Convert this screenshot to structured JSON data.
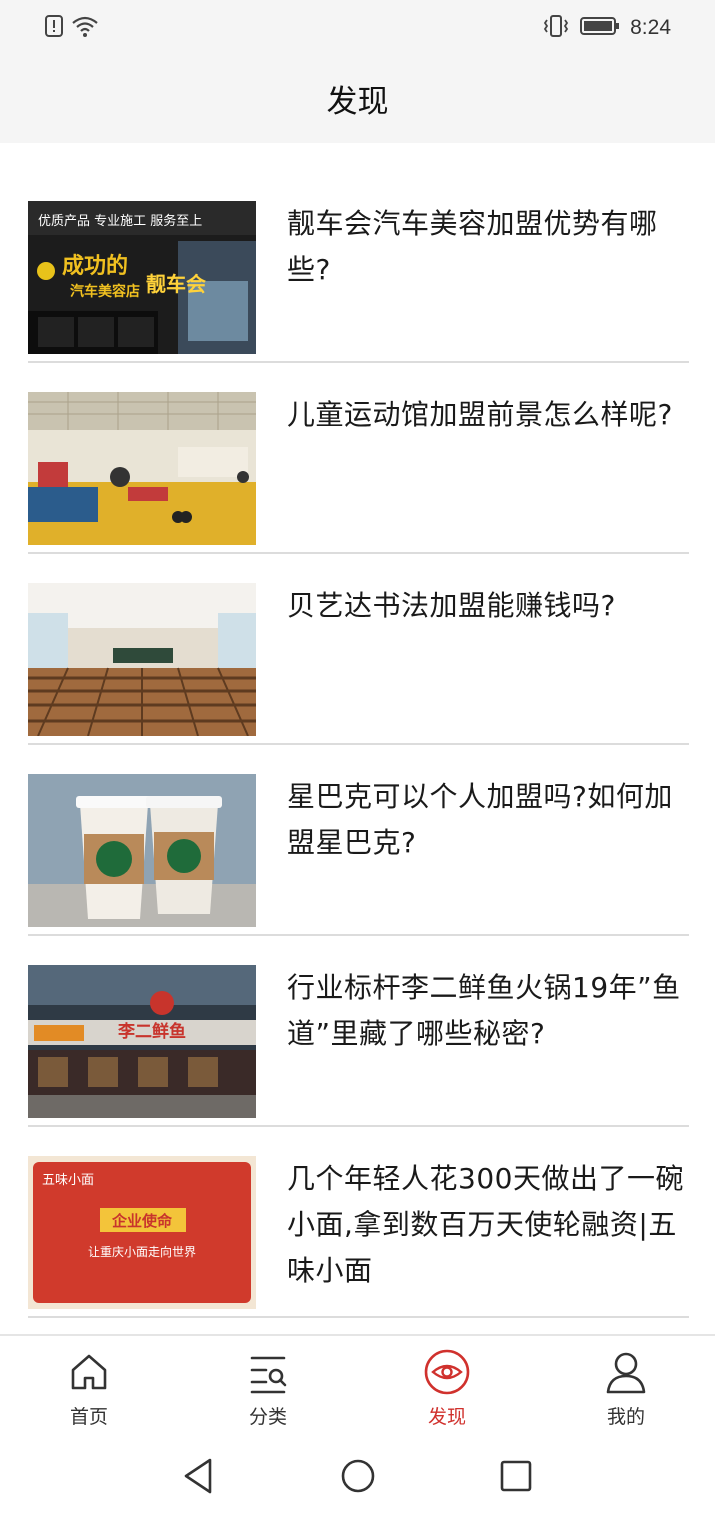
{
  "status_bar": {
    "time": "8:24",
    "icons": [
      "alert-icon",
      "wifi-icon",
      "vibrate-icon",
      "battery-icon"
    ]
  },
  "header": {
    "title": "发现"
  },
  "articles": [
    {
      "title": "靓车会汽车美容加盟优势有哪些?",
      "thumb_text": [
        "优质产品 专业施工 服务至上",
        "成功的",
        "汽车美容店",
        "靓车会"
      ]
    },
    {
      "title": "儿童运动馆加盟前景怎么样呢?"
    },
    {
      "title": "贝艺达书法加盟能赚钱吗?"
    },
    {
      "title": "星巴克可以个人加盟吗?如何加盟星巴克?"
    },
    {
      "title": "行业标杆李二鲜鱼火锅19年”鱼道”里藏了哪些秘密?",
      "thumb_text": [
        "李二鲜鱼"
      ]
    },
    {
      "title": "几个年轻人花300天做出了一碗小面,拿到数百万天使轮融资|五味小面",
      "thumb_text": [
        "五味小面",
        "企业使命",
        "让重庆小面走向世界"
      ]
    }
  ],
  "tabs": [
    {
      "label": "首页",
      "icon": "home-icon",
      "active": false
    },
    {
      "label": "分类",
      "icon": "category-search-icon",
      "active": false
    },
    {
      "label": "发现",
      "icon": "eye-icon",
      "active": true
    },
    {
      "label": "我的",
      "icon": "user-icon",
      "active": false
    }
  ],
  "colors": {
    "accent": "#d0312d",
    "header_bg": "#f5f5f5",
    "divider": "#dcdcdc"
  }
}
